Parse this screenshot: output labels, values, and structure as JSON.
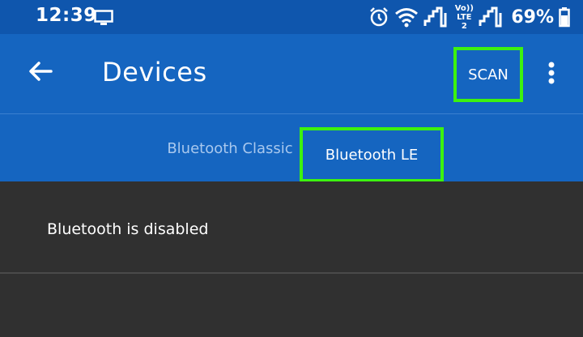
{
  "status_bar": {
    "time": "12:39",
    "battery_percent": "69%",
    "network_label": "Vo)) LTE2",
    "icons": [
      "screen-icon",
      "alarm-icon",
      "wifi-icon",
      "signal-icon",
      "lte-icon",
      "signal-icon",
      "battery-icon"
    ]
  },
  "app_bar": {
    "title": "Devices",
    "scan_label": "SCAN",
    "icons": [
      "back-arrow-icon",
      "more-vert-icon"
    ]
  },
  "tabs": [
    {
      "label": "Bluetooth Classic",
      "selected": false
    },
    {
      "label": "Bluetooth LE",
      "selected": true
    }
  ],
  "content": {
    "message": "Bluetooth is disabled"
  },
  "colors": {
    "status_bar": "#0f56ad",
    "app_bar": "#1565c0",
    "background": "#303030",
    "highlight": "#3df20f",
    "inactive_tab": "#a8c8ee"
  }
}
